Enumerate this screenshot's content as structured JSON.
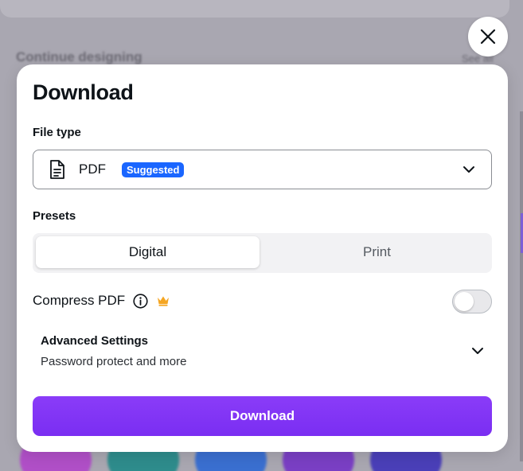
{
  "background": {
    "heading": "Continue designing",
    "link": "See all"
  },
  "dialog": {
    "title": "Download",
    "file_type": {
      "label": "File type",
      "value": "PDF",
      "badge": "Suggested",
      "icon": "document-icon"
    },
    "presets": {
      "label": "Presets",
      "options": [
        "Digital",
        "Print"
      ],
      "selected": "Digital"
    },
    "compress": {
      "label": "Compress PDF",
      "enabled": false
    },
    "advanced": {
      "title": "Advanced Settings",
      "subtitle": "Password protect and more"
    },
    "download_label": "Download"
  },
  "colors": {
    "accent": "#7d2ae8",
    "badge": "#1a66ff",
    "crown": "#f5a623"
  }
}
